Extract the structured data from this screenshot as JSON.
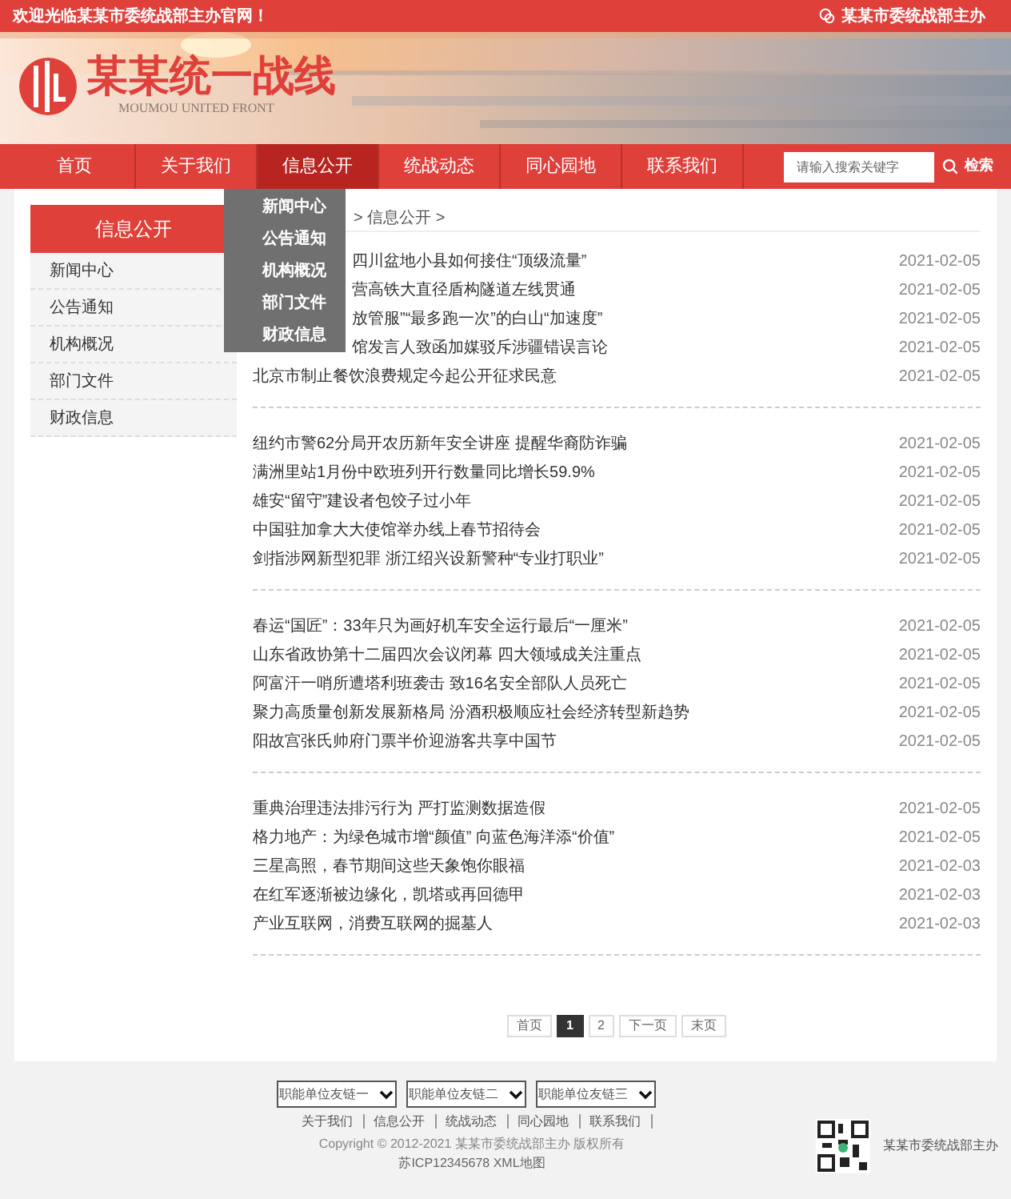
{
  "top_bar": {
    "welcome": "欢迎光临某某市委统战部主办官网！",
    "host": "某某市委统战部主办"
  },
  "logo": {
    "title": "某某统一战线",
    "subtitle": "MOUMOU UNITED FRONT"
  },
  "nav": {
    "items": [
      {
        "label": "首页",
        "selected": false
      },
      {
        "label": "关于我们",
        "selected": false
      },
      {
        "label": "信息公开",
        "selected": true
      },
      {
        "label": "统战动态",
        "selected": false
      },
      {
        "label": "同心园地",
        "selected": false
      },
      {
        "label": "联系我们",
        "selected": false
      }
    ],
    "search": {
      "placeholder": "请输入搜索关键字",
      "button": "检索"
    },
    "dropdown": [
      "新闻中心",
      "公告通知",
      "机构概况",
      "部门文件",
      "财政信息"
    ]
  },
  "sidebar": {
    "title": "信息公开",
    "items": [
      "新闻中心",
      "公告通知",
      "机构概况",
      "部门文件",
      "财政信息"
    ]
  },
  "breadcrumb": "> 信息公开 >",
  "news_groups": [
    [
      {
        "kind": "covered",
        "title": "四川盆地小县如何接住“顶级流量”",
        "date": "2021-02-05"
      },
      {
        "kind": "covered",
        "title": "营高铁大直径盾构隧道左线贯通",
        "date": "2021-02-05"
      },
      {
        "kind": "covered",
        "title": "放管服”“最多跑一次”的白山“加速度”",
        "date": "2021-02-05"
      },
      {
        "kind": "covered",
        "title": "馆发言人致函加媒驳斥涉疆错误言论",
        "date": "2021-02-05"
      },
      {
        "title": "北京市制止餐饮浪费规定今起公开征求民意",
        "date": "2021-02-05"
      }
    ],
    [
      {
        "title": "纽约市警62分局开农历新年安全讲座 提醒华裔防诈骗",
        "date": "2021-02-05"
      },
      {
        "title": "满洲里站1月份中欧班列开行数量同比增长59.9%",
        "date": "2021-02-05"
      },
      {
        "title": "雄安“留守”建设者包饺子过小年",
        "date": "2021-02-05"
      },
      {
        "title": "中国驻加拿大大使馆举办线上春节招待会",
        "date": "2021-02-05"
      },
      {
        "title": "剑指涉网新型犯罪 浙江绍兴设新警种“专业打职业”",
        "date": "2021-02-05"
      }
    ],
    [
      {
        "title": "春运“国匠”：33年只为画好机车安全运行最后“一厘米”",
        "date": "2021-02-05"
      },
      {
        "title": "山东省政协第十二届四次会议闭幕 四大领域成关注重点",
        "date": "2021-02-05"
      },
      {
        "title": "阿富汗一哨所遭塔利班袭击 致16名安全部队人员死亡",
        "date": "2021-02-05"
      },
      {
        "title": "聚力高质量创新发展新格局 汾酒积极顺应社会经济转型新趋势",
        "date": "2021-02-05"
      },
      {
        "title": "阳故宫张氏帅府门票半价迎游客共享中国节",
        "date": "2021-02-05"
      }
    ],
    [
      {
        "title": "重典治理违法排污行为 严打监测数据造假",
        "date": "2021-02-05"
      },
      {
        "title": "格力地产：为绿色城市增“颜值” 向蓝色海洋添“价值”",
        "date": "2021-02-05"
      },
      {
        "title": "三星高照，春节期间这些天象饱你眼福",
        "date": "2021-02-03"
      },
      {
        "title": "在红军逐渐被边缘化，凯塔或再回德甲",
        "date": "2021-02-03"
      },
      {
        "title": "产业互联网，消费互联网的掘墓人",
        "date": "2021-02-03"
      }
    ]
  ],
  "pagination": [
    {
      "label": "首页",
      "selected": false
    },
    {
      "label": "1",
      "selected": true
    },
    {
      "label": "2",
      "selected": false
    },
    {
      "label": "下一页",
      "selected": false
    },
    {
      "label": "末页",
      "selected": false
    }
  ],
  "footer": {
    "selects": [
      "职能单位友链一",
      "职能单位友链二",
      "职能单位友链三"
    ],
    "links": [
      "关于我们",
      "信息公开",
      "统战动态",
      "同心园地",
      "联系我们"
    ],
    "copyright": "Copyright © 2012-2021 某某市委统战部主办 版权所有",
    "icp": "苏ICP12345678 XML地图",
    "host": "某某市委统战部主办"
  }
}
